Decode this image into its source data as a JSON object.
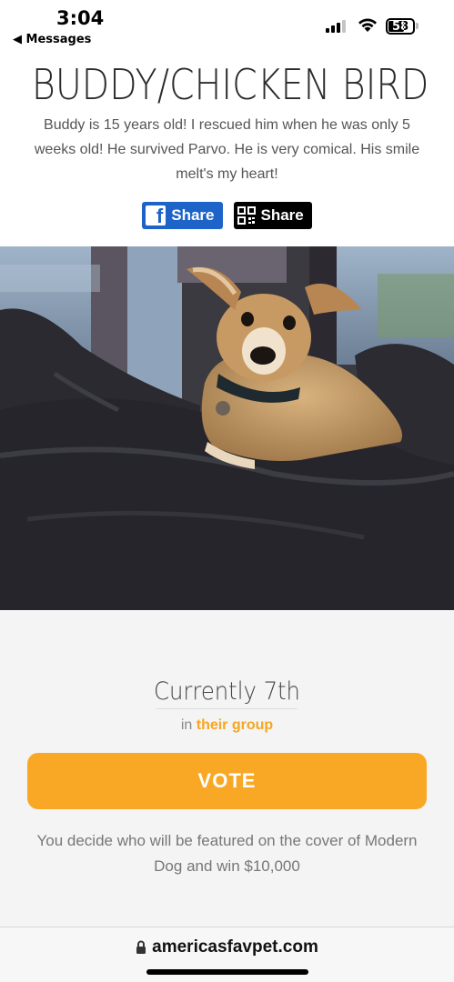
{
  "status_bar": {
    "time": "3:04",
    "back_label": "◀ Messages",
    "battery": "58",
    "signal_icon": "cellular-signal-icon",
    "wifi_icon": "wifi-icon",
    "battery_icon": "battery-icon"
  },
  "pet": {
    "name": "BUDDY/CHICKEN BIRD",
    "description": "Buddy is 15 years old! I rescued him when he was only 5 weeks old! He survived Parvo. He is very comical. His smile melt's my heart!"
  },
  "share": {
    "facebook_label": "Share",
    "qr_label": "Share"
  },
  "ranking": {
    "current": "Currently 7th",
    "group_prefix": "in",
    "group_link": "their group"
  },
  "vote": {
    "button_label": "VOTE",
    "footer_text": "You decide who will be featured on the cover of Modern Dog and win $10,000"
  },
  "browser": {
    "url": "americasfavpet.com"
  },
  "colors": {
    "accent": "#f9a825",
    "facebook": "#1e64c8"
  }
}
